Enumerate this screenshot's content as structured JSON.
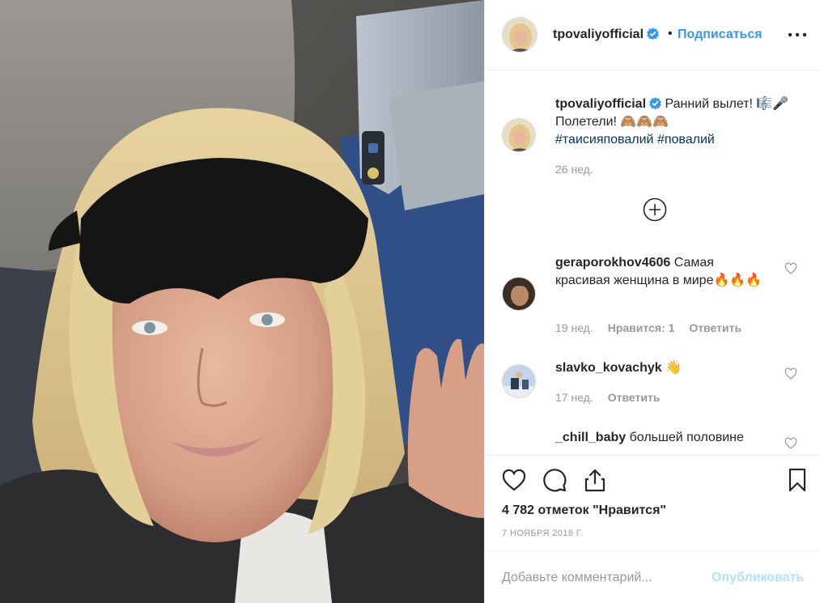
{
  "post": {
    "photo_alt": "",
    "author": "tpovaliyofficial",
    "verified": true,
    "follow_label": "Подписаться",
    "dot": "•",
    "more_icon": "more-dots-icon"
  },
  "caption": {
    "username": "tpovaliyofficial",
    "text_line1": " Ранний вылет! 🎼🎤",
    "text_line2": "Полетели! 🙈🙈🙈",
    "hashtag1": "#таисияповалий",
    "hashtag2": "#повалий",
    "time": "26 нед."
  },
  "load_more_icon": "plus-circle-icon",
  "comments": [
    {
      "username": "geraporokhov4606",
      "text": " Самая красивая женщина в мире🔥🔥🔥",
      "time": "19 нед.",
      "likes": "Нравится: 1",
      "reply": "Ответить"
    },
    {
      "username": "slavko_kovachyk",
      "text": " 👋",
      "time": "17 нед.",
      "reply": "Ответить"
    },
    {
      "username": "_chill_baby",
      "text": " большей половине"
    }
  ],
  "actions": {
    "like_icon": "heart-icon",
    "comment_icon": "comment-icon",
    "share_icon": "share-icon",
    "save_icon": "bookmark-icon",
    "likes_count": "4 782 отметок \"Нравится\"",
    "date": "7 НОЯБРЯ 2018 Г."
  },
  "add_comment": {
    "placeholder": "Добавьте комментарий...",
    "publish_label": "Опубликовать"
  },
  "colors": {
    "link_blue": "#3897f0",
    "hashtag_blue": "#003569",
    "muted": "#999999",
    "publish_disabled": "#b2dffc"
  }
}
